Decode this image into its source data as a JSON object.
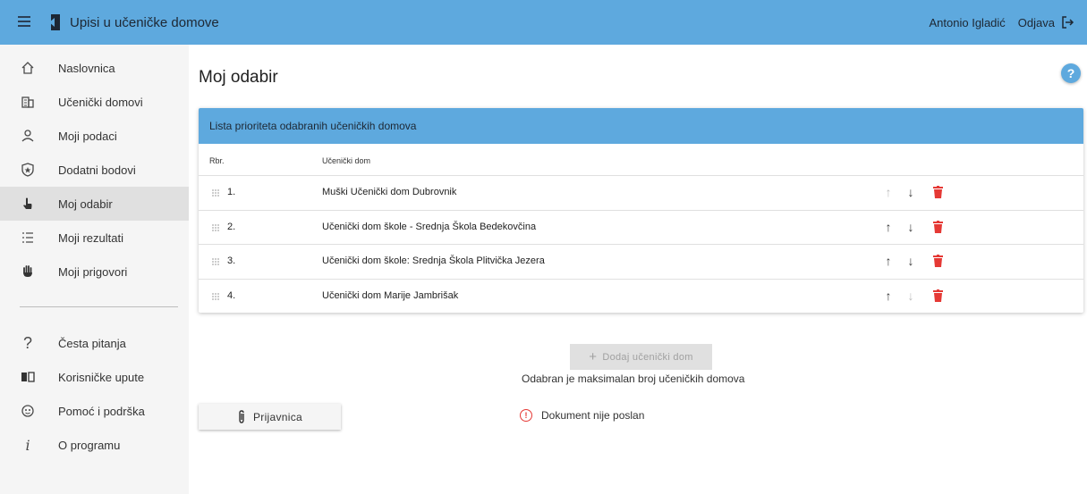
{
  "app": {
    "title": "Upisi u učeničke domove",
    "user_name": "Antonio Igladić",
    "logout_label": "Odjava"
  },
  "colors": {
    "primary": "#5ea9de",
    "danger": "#e53935",
    "sidebar_bg": "#f5f5f5",
    "active_bg": "#e0e0e0"
  },
  "sidebar": {
    "items": [
      {
        "label": "Naslovnica",
        "icon": "home-icon",
        "active": false
      },
      {
        "label": "Učenički domovi",
        "icon": "building-icon",
        "active": false
      },
      {
        "label": "Moji podaci",
        "icon": "user-icon",
        "active": false
      },
      {
        "label": "Dodatni bodovi",
        "icon": "star-shield-icon",
        "active": false
      },
      {
        "label": "Moj odabir",
        "icon": "pointing-hand-icon",
        "active": true
      },
      {
        "label": "Moji rezultati",
        "icon": "list-icon",
        "active": false
      },
      {
        "label": "Moji prigovori",
        "icon": "raised-hand-icon",
        "active": false
      }
    ],
    "secondary": [
      {
        "label": "Česta pitanja",
        "icon": "question-icon"
      },
      {
        "label": "Korisničke upute",
        "icon": "book-icon"
      },
      {
        "label": "Pomoć i podrška",
        "icon": "support-icon"
      },
      {
        "label": "O programu",
        "icon": "info-icon"
      }
    ]
  },
  "main": {
    "title": "Moj odabir",
    "help_label": "?",
    "list": {
      "header": "Lista prioriteta odabranih učeničkih domova",
      "col_rbr": "Rbr.",
      "col_dom": "Učenički dom",
      "rows": [
        {
          "num": "1.",
          "name": "Muški Učenički dom Dubrovnik",
          "up_enabled": false,
          "down_enabled": true
        },
        {
          "num": "2.",
          "name": "Učenički dom škole - Srednja Škola Bedekovčina",
          "up_enabled": true,
          "down_enabled": true
        },
        {
          "num": "3.",
          "name": "Učenički dom škole: Srednja Škola Plitvička Jezera",
          "up_enabled": true,
          "down_enabled": true
        },
        {
          "num": "4.",
          "name": "Učenički dom Marije Jambrišak",
          "up_enabled": true,
          "down_enabled": false
        }
      ]
    },
    "add_button": "Dodaj učenički dom",
    "max_message": "Odabran je maksimalan broj učeničkih domova",
    "prijavnica_button": "Prijavnica",
    "document_status": "Dokument nije poslan"
  }
}
